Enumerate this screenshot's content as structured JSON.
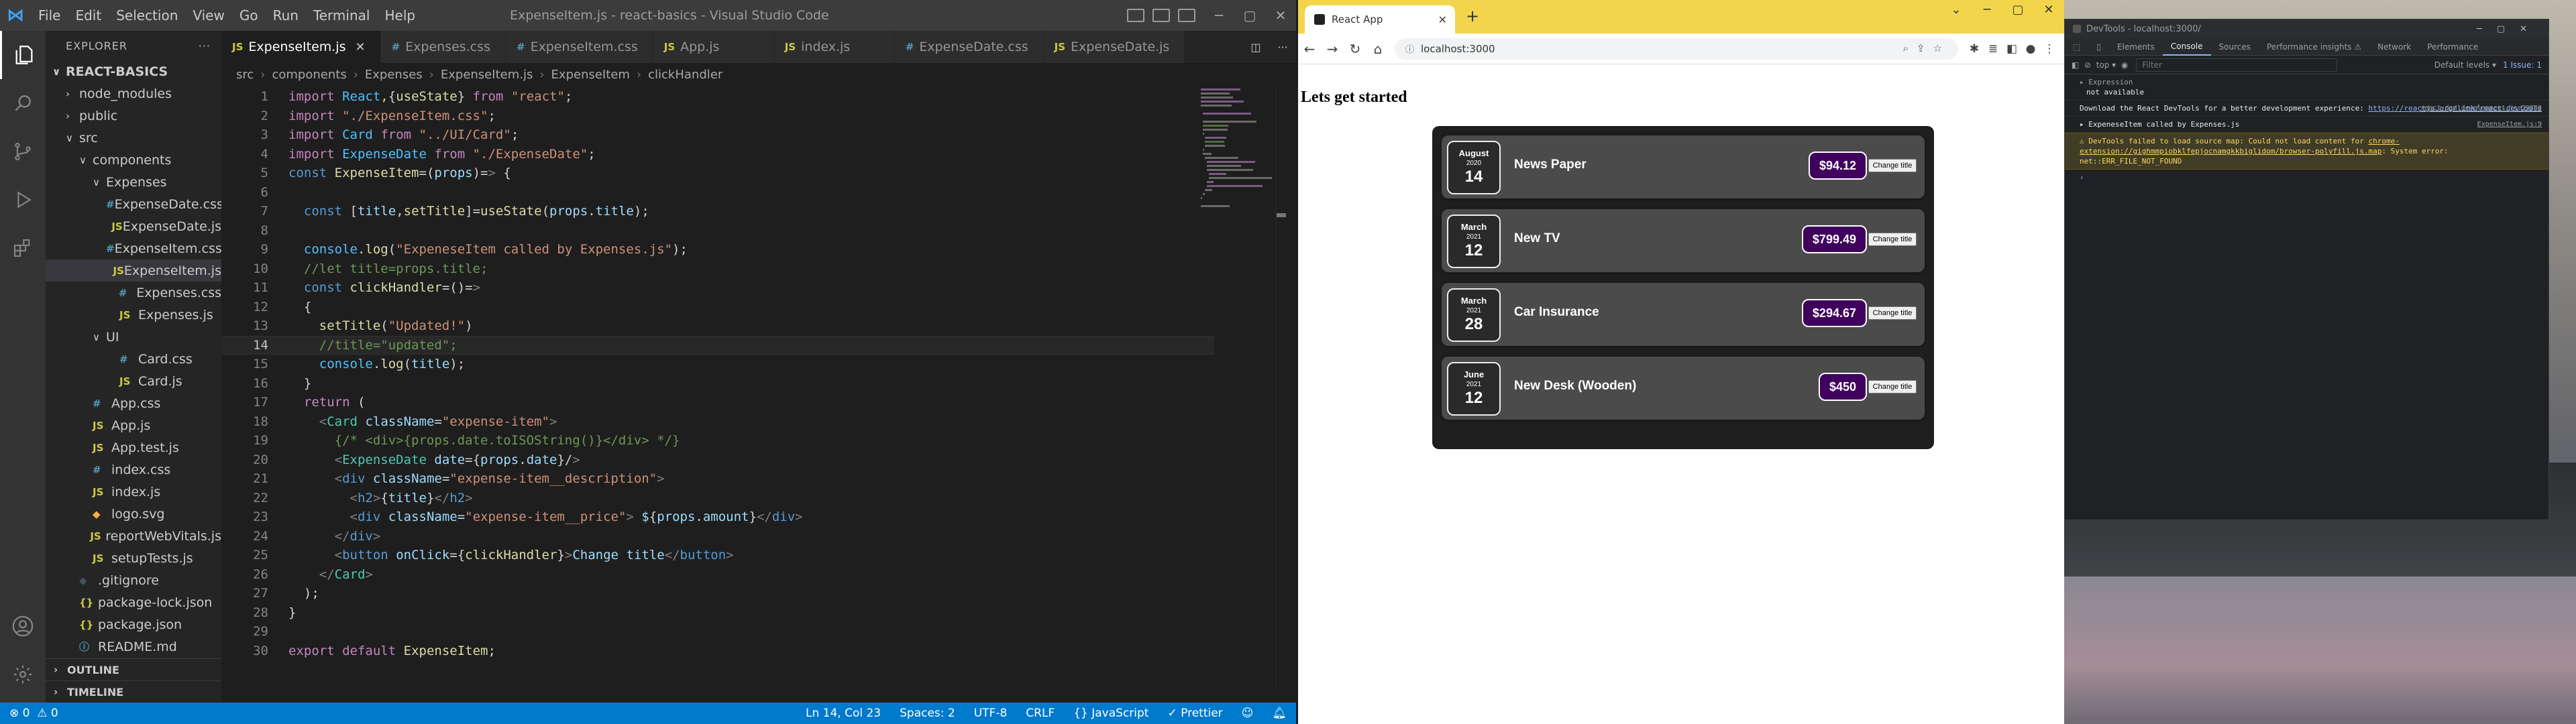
{
  "vscode": {
    "window_title": "ExpenseItem.js - react-basics - Visual Studio Code",
    "menu": [
      "File",
      "Edit",
      "Selection",
      "View",
      "Go",
      "Run",
      "Terminal",
      "Help"
    ],
    "explorer_title": "EXPLORER",
    "tree": [
      {
        "label": "REACT-BASICS",
        "indent": 0,
        "chev": "∨",
        "icon": "",
        "type": "root"
      },
      {
        "label": "node_modules",
        "indent": 1,
        "chev": "›",
        "icon": "",
        "type": "folder"
      },
      {
        "label": "public",
        "indent": 1,
        "chev": "›",
        "icon": "",
        "type": "folder"
      },
      {
        "label": "src",
        "indent": 1,
        "chev": "∨",
        "icon": "",
        "type": "folder"
      },
      {
        "label": "components",
        "indent": 2,
        "chev": "∨",
        "icon": "",
        "type": "folder"
      },
      {
        "label": "Expenses",
        "indent": 3,
        "chev": "∨",
        "icon": "",
        "type": "folder"
      },
      {
        "label": "ExpenseDate.css",
        "indent": 4,
        "chev": "",
        "icon": "#",
        "type": "css"
      },
      {
        "label": "ExpenseDate.js",
        "indent": 4,
        "chev": "",
        "icon": "JS",
        "type": "js"
      },
      {
        "label": "ExpenseItem.css",
        "indent": 4,
        "chev": "",
        "icon": "#",
        "type": "css"
      },
      {
        "label": "ExpenseItem.js",
        "indent": 4,
        "chev": "",
        "icon": "JS",
        "type": "js",
        "selected": true
      },
      {
        "label": "Expenses.css",
        "indent": 4,
        "chev": "",
        "icon": "#",
        "type": "css"
      },
      {
        "label": "Expenses.js",
        "indent": 4,
        "chev": "",
        "icon": "JS",
        "type": "js"
      },
      {
        "label": "UI",
        "indent": 3,
        "chev": "∨",
        "icon": "",
        "type": "folder"
      },
      {
        "label": "Card.css",
        "indent": 4,
        "chev": "",
        "icon": "#",
        "type": "css"
      },
      {
        "label": "Card.js",
        "indent": 4,
        "chev": "",
        "icon": "JS",
        "type": "js"
      },
      {
        "label": "App.css",
        "indent": 2,
        "chev": "",
        "icon": "#",
        "type": "css"
      },
      {
        "label": "App.js",
        "indent": 2,
        "chev": "",
        "icon": "JS",
        "type": "js"
      },
      {
        "label": "App.test.js",
        "indent": 2,
        "chev": "",
        "icon": "JS",
        "type": "js"
      },
      {
        "label": "index.css",
        "indent": 2,
        "chev": "",
        "icon": "#",
        "type": "css"
      },
      {
        "label": "index.js",
        "indent": 2,
        "chev": "",
        "icon": "JS",
        "type": "js"
      },
      {
        "label": "logo.svg",
        "indent": 2,
        "chev": "",
        "icon": "◆",
        "type": "svg"
      },
      {
        "label": "reportWebVitals.js",
        "indent": 2,
        "chev": "",
        "icon": "JS",
        "type": "js"
      },
      {
        "label": "setupTests.js",
        "indent": 2,
        "chev": "",
        "icon": "JS",
        "type": "js"
      },
      {
        "label": ".gitignore",
        "indent": 1,
        "chev": "",
        "icon": "◆",
        "type": "git"
      },
      {
        "label": "package-lock.json",
        "indent": 1,
        "chev": "",
        "icon": "{}",
        "type": "json"
      },
      {
        "label": "package.json",
        "indent": 1,
        "chev": "",
        "icon": "{}",
        "type": "json"
      },
      {
        "label": "README.md",
        "indent": 1,
        "chev": "",
        "icon": "ⓘ",
        "type": "md"
      }
    ],
    "outline_label": "OUTLINE",
    "timeline_label": "TIMELINE",
    "tabs": [
      {
        "label": "ExpenseItem.js",
        "icon": "JS",
        "type": "js",
        "active": true
      },
      {
        "label": "Expenses.css",
        "icon": "#",
        "type": "css"
      },
      {
        "label": "ExpenseItem.css",
        "icon": "#",
        "type": "css"
      },
      {
        "label": "App.js",
        "icon": "JS",
        "type": "js"
      },
      {
        "label": "index.js",
        "icon": "JS",
        "type": "js"
      },
      {
        "label": "ExpenseDate.css",
        "icon": "#",
        "type": "css"
      },
      {
        "label": "ExpenseDate.js",
        "icon": "JS",
        "type": "js"
      }
    ],
    "breadcrumb": [
      "src",
      "components",
      "Expenses",
      "ExpenseItem.js",
      "ExpenseItem",
      "clickHandler"
    ],
    "current_line": 14,
    "code_lines": [
      "import React,{useState} from \"react\";",
      "import \"./ExpenseItem.css\";",
      "import Card from \"../UI/Card\";",
      "import ExpenseDate from \"./ExpenseDate\";",
      "const ExpenseItem=(props)=> {",
      "",
      "  const [title,setTitle]=useState(props.title);",
      "",
      "  console.log(\"ExpeneseItem called by Expenses.js\");",
      "  //let title=props.title;",
      "  const clickHandler=()=>",
      "  {",
      "    setTitle(\"Updated!\")",
      "    //title=\"updated\";",
      "    console.log(title);",
      "  }",
      "  return (",
      "    <Card className=\"expense-item\">",
      "      {/* <div>{props.date.toISOString()}</div> */}",
      "      <ExpenseDate date={props.date}/>",
      "      <div className=\"expense-item__description\">",
      "        <h2>{title}</h2>",
      "        <div className=\"expense-item__price\"> ${props.amount}</div>",
      "      </div>",
      "      <button onClick={clickHandler}>Change title</button>",
      "    </Card>",
      "  );",
      "}",
      "",
      "export default ExpenseItem;"
    ],
    "status": {
      "errors": "⊗ 0",
      "warnings": "⚠ 0",
      "position": "Ln 14, Col 23",
      "spaces": "Spaces: 2",
      "encoding": "UTF-8",
      "eol": "CRLF",
      "language": "{} JavaScript",
      "prettier": "✓ Prettier"
    }
  },
  "browser": {
    "tab_title": "React App",
    "url": "localhost:3000",
    "app": {
      "heading": "Lets get started",
      "button_label": "Change title",
      "expenses": [
        {
          "month": "August",
          "year": "2020",
          "day": "14",
          "title": "News Paper",
          "amount": "$94.12"
        },
        {
          "month": "March",
          "year": "2021",
          "day": "12",
          "title": "New TV",
          "amount": "$799.49"
        },
        {
          "month": "March",
          "year": "2021",
          "day": "28",
          "title": "Car Insurance",
          "amount": "$294.67"
        },
        {
          "month": "June",
          "year": "2021",
          "day": "12",
          "title": "New Desk (Wooden)",
          "amount": "$450"
        }
      ]
    }
  },
  "devtools": {
    "title": "DevTools - localhost:3000/",
    "tabs": [
      "Elements",
      "Console",
      "Sources",
      "Performance insights ⚠",
      "Network",
      "Performance"
    ],
    "active_tab": "Console",
    "context": "top ▾",
    "filter_placeholder": "Filter",
    "levels": "Default levels ▾",
    "issues": "1 Issue: 1",
    "expression_label": "▸ Expression",
    "expression_value": "not available",
    "messages": [
      {
        "kind": "log",
        "text": "Download the React DevTools for a better development experience: ",
        "link": "https://reactjs.org/link/react-devtools",
        "source": "react-dom.development.js:29840"
      },
      {
        "kind": "log",
        "text": "▸ ExpeneseItem called by Expenses.js",
        "link": "",
        "source": "ExpenseItem.js:9"
      },
      {
        "kind": "warn",
        "text": "⚠ DevTools failed to load source map: Could not load content for ",
        "link": "chrome-extension://gighmmpiobklfepjocnamgkkbiglidom/browser-polyfill.js.map",
        "tail": ": System error: net::ERR_FILE_NOT_FOUND",
        "source": ""
      }
    ]
  },
  "colors": {
    "vscode_bg": "#1e1e1e",
    "statusbar": "#007acc",
    "browser_tab_strip": "#f2d54a",
    "expense_price_bg": "#40005d"
  }
}
